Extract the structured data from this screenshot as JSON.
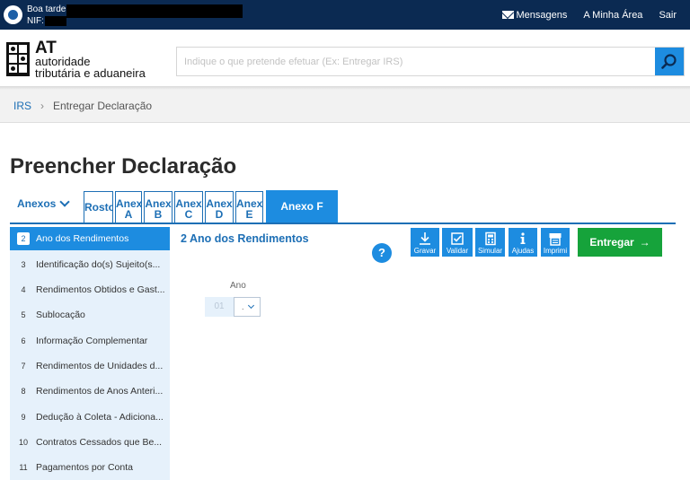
{
  "topbar": {
    "greeting": "Boa tarde,",
    "nif_label": "NIF:",
    "links": [
      "Mensagens",
      "A Minha Área",
      "Sair"
    ]
  },
  "logo": {
    "abbr": "AT",
    "line1": "autoridade",
    "line2": "tributária e aduaneira"
  },
  "search": {
    "placeholder": "Indique o que pretende efetuar (Ex: Entregar IRS)"
  },
  "breadcrumb": {
    "root": "IRS",
    "separator": "›",
    "current": "Entregar Declaração"
  },
  "page_title": "Preencher Declaração",
  "tabs": {
    "dropdown_label": "Anexos",
    "items": [
      {
        "line1": "Rosto",
        "line2": ""
      },
      {
        "line1": "Anex",
        "line2": "A"
      },
      {
        "line1": "Anex",
        "line2": "B"
      },
      {
        "line1": "Anex",
        "line2": "C"
      },
      {
        "line1": "Anex",
        "line2": "D"
      },
      {
        "line1": "Anex",
        "line2": "E"
      },
      {
        "line1": "Anexo F",
        "line2": ""
      }
    ],
    "active_index": 6
  },
  "sidebar": {
    "items": [
      {
        "num": "2",
        "label": "Ano dos Rendimentos"
      },
      {
        "num": "3",
        "label": "Identificação do(s) Sujeito(s..."
      },
      {
        "num": "4",
        "label": "Rendimentos Obtidos e Gast..."
      },
      {
        "num": "5",
        "label": "Sublocação"
      },
      {
        "num": "6",
        "label": "Informação Complementar"
      },
      {
        "num": "7",
        "label": "Rendimentos de Unidades d..."
      },
      {
        "num": "8",
        "label": "Rendimentos de Anos Anteri..."
      },
      {
        "num": "9",
        "label": "Dedução à Coleta - Adiciona..."
      },
      {
        "num": "10",
        "label": "Contratos Cessados que Be..."
      },
      {
        "num": "11",
        "label": "Pagamentos por Conta"
      }
    ],
    "active_index": 0
  },
  "section": {
    "title": "2  Ano dos Rendimentos",
    "help": "?",
    "tools": [
      "Gravar",
      "Validar",
      "Simular",
      "Ajudas",
      "Imprimi"
    ],
    "submit": "Entregar",
    "submit_arrow": "→",
    "ano_label": "Ano",
    "ano_value": "01",
    "ano_select_value": "."
  },
  "colors": {
    "topbar": "#0b2a52",
    "accent": "#1d8ce0",
    "link": "#1d6fb5",
    "submit": "#16a33b",
    "sidebar_bg": "#e6f1fb"
  }
}
